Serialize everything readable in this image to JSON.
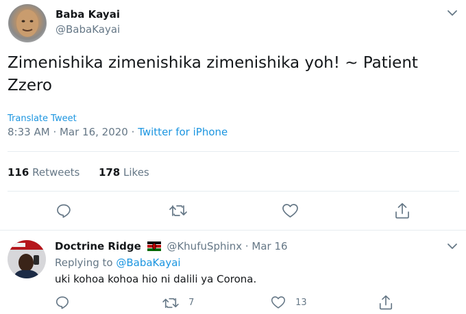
{
  "tweet": {
    "author_name": "Baba Kayai",
    "author_handle": "@BabaKayai",
    "text": "Zimenishika zimenishika zimenishika yoh! ~ Patient Zzero",
    "translate": "Translate Tweet",
    "time": "8:33 AM",
    "date": "Mar 16, 2020",
    "client": "Twitter for iPhone",
    "retweets_count": "116",
    "retweets_label": "Retweets",
    "likes_count": "178",
    "likes_label": "Likes"
  },
  "reply": {
    "author_name": "Doctrine Ridge",
    "flag_icon": "kenya-flag-icon",
    "author_handle": "@KhufuSphinx",
    "date": "Mar 16",
    "replying_prefix": "Replying to",
    "replying_handle": "@BabaKayai",
    "text": "uki kohoa kohoa hio ni dalili ya Corona.",
    "retweet_count": "7",
    "like_count": "13"
  },
  "colors": {
    "link": "#1b95e0",
    "muted": "#657786",
    "text": "#14171a",
    "divider": "#e6ecf0"
  },
  "icons": [
    "chevron-down-icon",
    "reply-icon",
    "retweet-icon",
    "like-icon",
    "share-icon"
  ]
}
